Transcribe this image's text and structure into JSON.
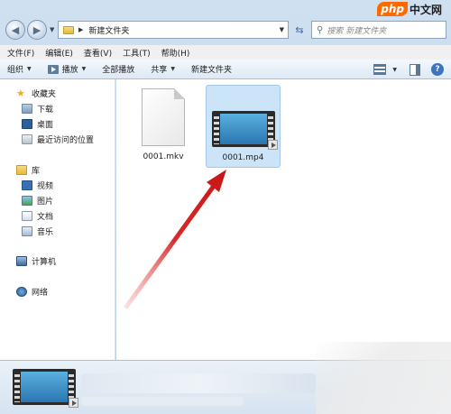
{
  "address": {
    "path": "新建文件夹",
    "search_placeholder": "搜索 新建文件夹"
  },
  "menu": [
    "文件(F)",
    "编辑(E)",
    "查看(V)",
    "工具(T)",
    "帮助(H)"
  ],
  "toolbar": {
    "organize": "组织",
    "play": "播放",
    "play_all": "全部播放",
    "share": "共享",
    "new_folder": "新建文件夹"
  },
  "nav": {
    "favorites": "收藏夹",
    "downloads": "下载",
    "desktop": "桌面",
    "recent": "最近访问的位置",
    "libraries": "库",
    "videos": "视频",
    "pictures": "图片",
    "documents": "文档",
    "music": "音乐",
    "computer": "计算机",
    "network": "网络"
  },
  "files": [
    {
      "name": "0001.mkv",
      "icon": "blank-page-icon",
      "selected": false
    },
    {
      "name": "0001.mp4",
      "icon": "video-file-icon",
      "selected": true
    }
  ],
  "logo": {
    "part1": "php",
    "part2": "中文网"
  }
}
